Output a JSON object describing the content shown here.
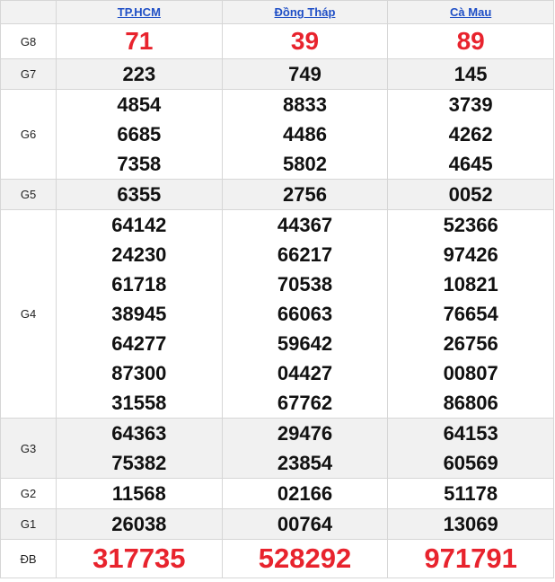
{
  "provinces": [
    "TP.HCM",
    "Đồng Tháp",
    "Cà Mau"
  ],
  "prizes": [
    {
      "label": "G8",
      "style": "big",
      "shade": false,
      "values": [
        [
          "71"
        ],
        [
          "39"
        ],
        [
          "89"
        ]
      ]
    },
    {
      "label": "G7",
      "style": "normal",
      "shade": true,
      "values": [
        [
          "223"
        ],
        [
          "749"
        ],
        [
          "145"
        ]
      ]
    },
    {
      "label": "G6",
      "style": "normal",
      "shade": false,
      "values": [
        [
          "4854",
          "6685",
          "7358"
        ],
        [
          "8833",
          "4486",
          "5802"
        ],
        [
          "3739",
          "4262",
          "4645"
        ]
      ]
    },
    {
      "label": "G5",
      "style": "normal",
      "shade": true,
      "values": [
        [
          "6355"
        ],
        [
          "2756"
        ],
        [
          "0052"
        ]
      ]
    },
    {
      "label": "G4",
      "style": "normal",
      "shade": false,
      "values": [
        [
          "64142",
          "24230",
          "61718",
          "38945",
          "64277",
          "87300",
          "31558"
        ],
        [
          "44367",
          "66217",
          "70538",
          "66063",
          "59642",
          "04427",
          "67762"
        ],
        [
          "52366",
          "97426",
          "10821",
          "76654",
          "26756",
          "00807",
          "86806"
        ]
      ]
    },
    {
      "label": "G3",
      "style": "normal",
      "shade": true,
      "values": [
        [
          "64363",
          "75382"
        ],
        [
          "29476",
          "23854"
        ],
        [
          "64153",
          "60569"
        ]
      ]
    },
    {
      "label": "G2",
      "style": "normal",
      "shade": false,
      "values": [
        [
          "11568"
        ],
        [
          "02166"
        ],
        [
          "51178"
        ]
      ]
    },
    {
      "label": "G1",
      "style": "normal",
      "shade": true,
      "values": [
        [
          "26038"
        ],
        [
          "00764"
        ],
        [
          "13069"
        ]
      ]
    },
    {
      "label": "ĐB",
      "style": "huge",
      "shade": false,
      "values": [
        [
          "317735"
        ],
        [
          "528292"
        ],
        [
          "971791"
        ]
      ]
    }
  ]
}
